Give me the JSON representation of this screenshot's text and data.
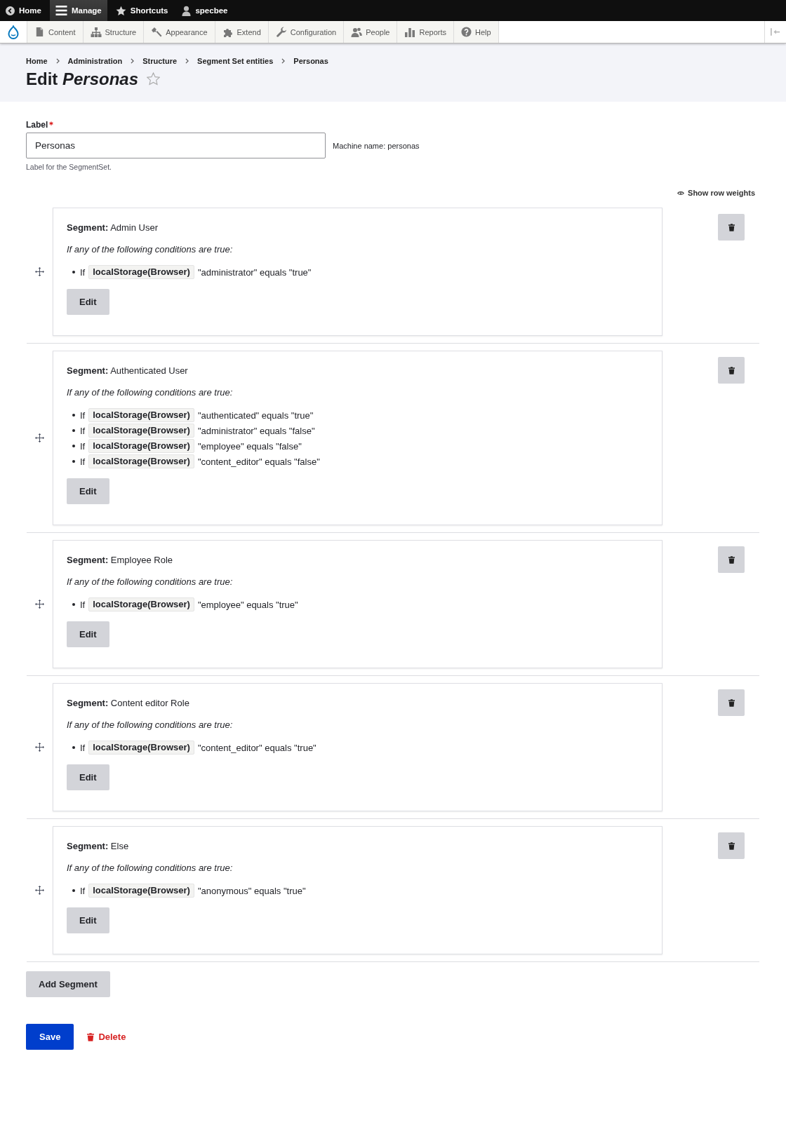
{
  "toolbar": {
    "tabs": [
      {
        "label": "Home",
        "selected": false
      },
      {
        "label": "Manage",
        "selected": true
      },
      {
        "label": "Shortcuts",
        "selected": false
      },
      {
        "label": "specbee",
        "selected": false
      }
    ]
  },
  "admin_menu": {
    "items": [
      {
        "label": "Content",
        "selected": false
      },
      {
        "label": "Structure",
        "selected": false
      },
      {
        "label": "Appearance",
        "selected": false
      },
      {
        "label": "Extend",
        "selected": false
      },
      {
        "label": "Configuration",
        "selected": false
      },
      {
        "label": "People",
        "selected": false
      },
      {
        "label": "Reports",
        "selected": false
      },
      {
        "label": "Help",
        "selected": false
      }
    ]
  },
  "breadcrumb": [
    {
      "label": "Home"
    },
    {
      "label": "Administration"
    },
    {
      "label": "Structure"
    },
    {
      "label": "Segment Set entities"
    },
    {
      "label": "Personas"
    }
  ],
  "page_title": {
    "text": "Edit *Personas*",
    "starred": false
  },
  "label_field": {
    "label": "Label",
    "required": true,
    "value": "Personas",
    "machine_name": "Machine name: personas",
    "description": "Label for the SegmentSet."
  },
  "show_row_weights": {
    "label": "Show row weights"
  },
  "segments": [
    {
      "title": "**Segment:** Admin User",
      "intro": "If any of the following conditions are true:",
      "conditions": [
        {
          "prefix": "If",
          "source": "localStorage(Browser)",
          "rule": "\"administrator\" equals \"true\""
        }
      ],
      "edit_label": "Edit"
    },
    {
      "title": "**Segment:** Authenticated User",
      "intro": "If any of the following conditions are true:",
      "conditions": [
        {
          "prefix": "If",
          "source": "localStorage(Browser)",
          "rule": "\"authenticated\" equals \"true\""
        },
        {
          "prefix": "If",
          "source": "localStorage(Browser)",
          "rule": "\"administrator\" equals \"false\""
        },
        {
          "prefix": "If",
          "source": "localStorage(Browser)",
          "rule": "\"employee\" equals \"false\""
        },
        {
          "prefix": "If",
          "source": "localStorage(Browser)",
          "rule": "\"content_editor\" equals \"false\""
        }
      ],
      "edit_label": "Edit"
    },
    {
      "title": "**Segment:** Employee Role",
      "intro": "If any of the following conditions are true:",
      "conditions": [
        {
          "prefix": "If",
          "source": "localStorage(Browser)",
          "rule": "\"employee\" equals \"true\""
        }
      ],
      "edit_label": "Edit"
    },
    {
      "title": "**Segment:** Content editor Role",
      "intro": "If any of the following conditions are true:",
      "conditions": [
        {
          "prefix": "If",
          "source": "localStorage(Browser)",
          "rule": "\"content_editor\" equals \"true\""
        }
      ],
      "edit_label": "Edit"
    },
    {
      "title": "**Segment:** Else",
      "intro": "If any of the following conditions are true:",
      "conditions": [
        {
          "prefix": "If",
          "source": "localStorage(Browser)",
          "rule": "\"anonymous\" equals \"true\""
        }
      ],
      "edit_label": "Edit"
    }
  ],
  "add_segment": {
    "label": "Add Segment"
  },
  "actions": {
    "save": "Save",
    "delete": "Delete"
  }
}
